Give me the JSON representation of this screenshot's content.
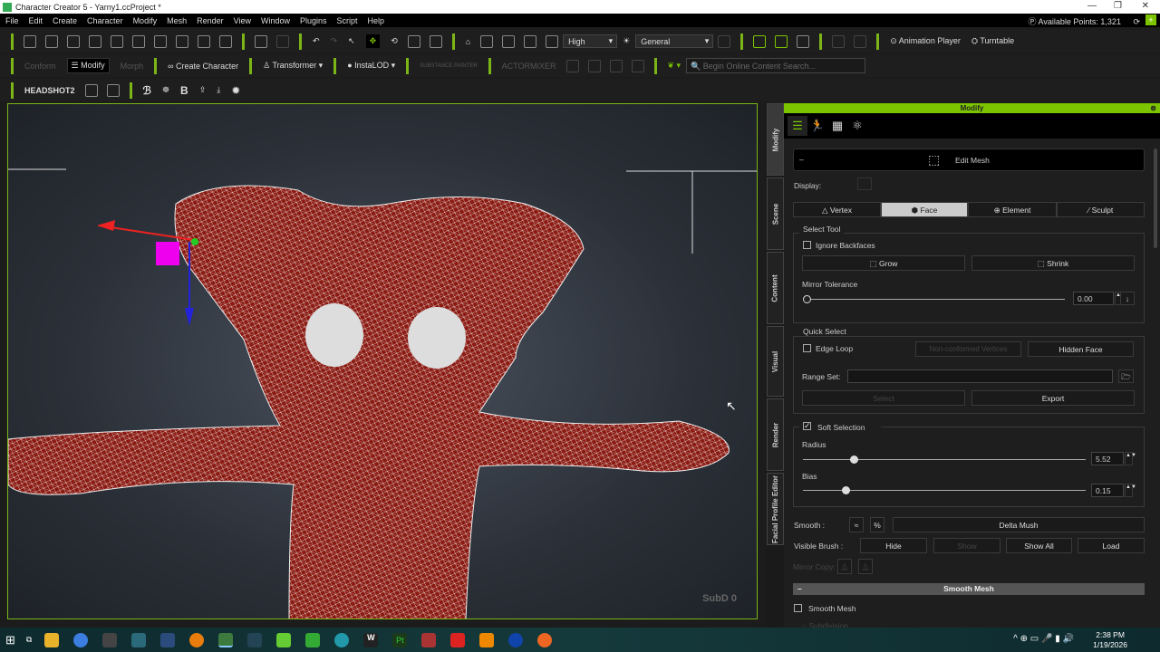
{
  "window": {
    "title": "Character Creator 5 - Yarny1.ccProject *"
  },
  "menu": [
    "File",
    "Edit",
    "Create",
    "Character",
    "Modify",
    "Mesh",
    "Render",
    "View",
    "Window",
    "Plugins",
    "Script",
    "Help"
  ],
  "points": "Available Points: 1,321",
  "toolbar1": {
    "quality": "High",
    "lighting": "General",
    "animation_player": "Animation Player",
    "turntable": "Turntable"
  },
  "toolbar2": {
    "conform": "Conform",
    "modify": "Modify",
    "morph": "Morph",
    "create_character": "Create Character",
    "transformer": "Transformer",
    "instalod": "InstaLOD",
    "substance": "SUBSTANCE PAINTER",
    "actormixer": "ACTORMIXER",
    "search_placeholder": "Begin Online Content Search..."
  },
  "toolbar3": {
    "headshot": "HEADSHOT2"
  },
  "viewport": {
    "subd": "SubD 0"
  },
  "side_tabs": [
    "Modify",
    "Scene",
    "Content",
    "Visual",
    "Render",
    "Facial Profile Editor"
  ],
  "panel": {
    "title": "Modify",
    "edit_mesh": "Edit Mesh",
    "collapse": "–",
    "display_label": "Display:",
    "modes": [
      "Vertex",
      "Face",
      "Element",
      "Sculpt"
    ],
    "active_mode": "Face",
    "select_tool": {
      "title": "Select Tool",
      "ignore_backfaces": "Ignore Backfaces",
      "grow": "Grow",
      "shrink": "Shrink",
      "mirror_tolerance": "Mirror Tolerance",
      "mirror_value": "0.00"
    },
    "quick_select": {
      "title": "Quick Select",
      "edge_loop": "Edge Loop",
      "non_conformed": "Non-conformed Vertices",
      "hidden_face": "Hidden Face",
      "range_set": "Range Set:",
      "select": "Select",
      "export": "Export"
    },
    "soft_selection": {
      "title": "Soft Selection",
      "checked": true,
      "radius_label": "Radius",
      "radius": "5.52",
      "radius_fraction": 0.18,
      "bias_label": "Bias",
      "bias": "0.15",
      "bias_fraction": 0.15
    },
    "smooth_label": "Smooth :",
    "delta_mush": "Delta Mush",
    "visible_brush": {
      "label": "Visible Brush :",
      "hide": "Hide",
      "show": "Show",
      "show_all": "Show All",
      "load": "Load"
    },
    "mirror_copy": "Mirror Copy:",
    "smooth_mesh_header": "Smooth Mesh",
    "smooth_mesh": "Smooth Mesh",
    "subdivision": "Subdivision"
  },
  "taskbar": {
    "time": "2:38 PM",
    "date": "1/19/2026"
  }
}
